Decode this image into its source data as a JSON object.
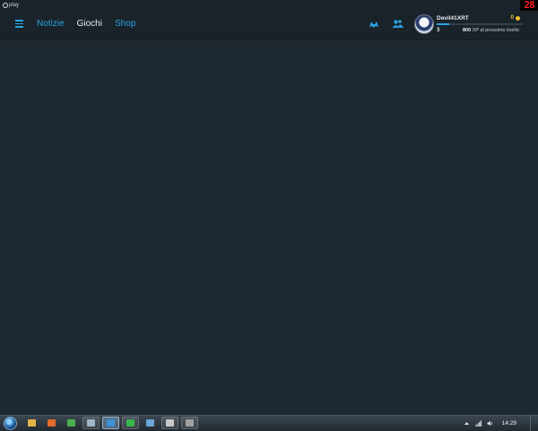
{
  "brand": {
    "label": "play"
  },
  "fps_counter": "28",
  "nav": {
    "items": [
      {
        "label": "Notizie",
        "active": false
      },
      {
        "label": "Giochi",
        "active": true
      },
      {
        "label": "Shop",
        "active": false
      }
    ]
  },
  "header_icons": [
    "gamepad-icon",
    "friends-icon"
  ],
  "profile": {
    "username": "Devil41XRT",
    "coins": "0",
    "level": "3",
    "xp_needed": "800",
    "xp_suffix": "XP al prossimo livello",
    "xp_progress": 0.15
  },
  "taskbar": {
    "items": [
      {
        "icon": "folder-icon",
        "color": "#e3b34a",
        "state": "none"
      },
      {
        "icon": "media-icon",
        "color": "#e56b2e",
        "state": "none"
      },
      {
        "icon": "chrome-icon",
        "color": "#4caf50",
        "state": "none"
      },
      {
        "icon": "steam-icon",
        "color": "#9fb6cc",
        "state": "open"
      },
      {
        "icon": "uplay-icon",
        "color": "#3d8fd6",
        "state": "active"
      },
      {
        "icon": "green-app-icon",
        "color": "#39b54a",
        "state": "open"
      },
      {
        "icon": "window-icon",
        "color": "#6aa6d8",
        "state": "none"
      },
      {
        "icon": "tool-icon",
        "color": "#c8c8c8",
        "state": "open"
      },
      {
        "icon": "game-icon",
        "color": "#a0a0a0",
        "state": "open"
      }
    ],
    "clock": "14:29"
  },
  "colors": {
    "accent": "#2aa3e0",
    "background": "#1e2830",
    "header": "#1a232a",
    "coin": "#f1c232",
    "fps": "#ff2020"
  }
}
